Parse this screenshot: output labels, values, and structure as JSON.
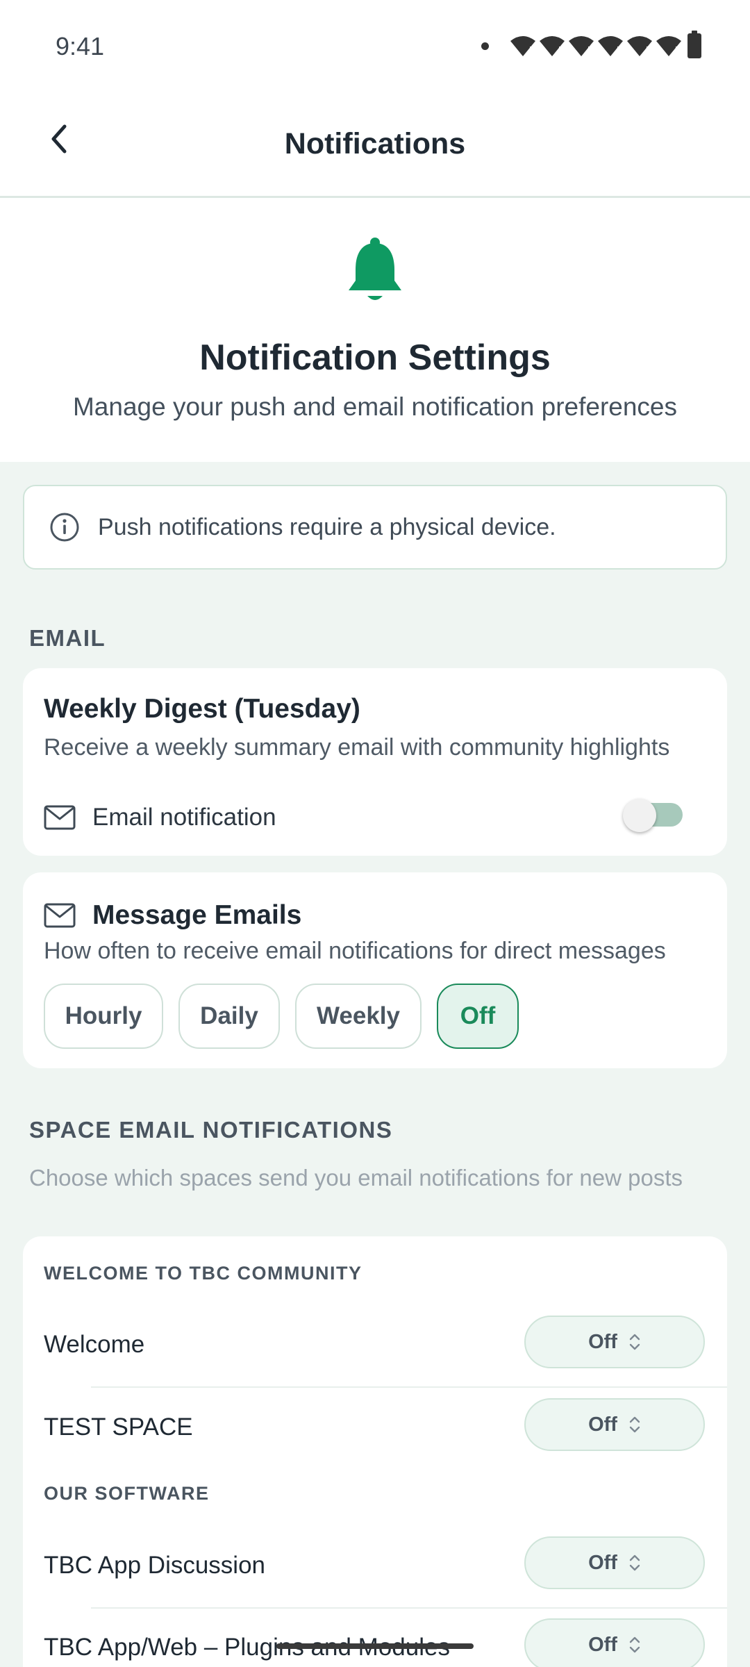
{
  "status_bar": {
    "time": "9:41"
  },
  "header": {
    "title": "Notifications"
  },
  "hero": {
    "title": "Notification Settings",
    "subtitle": "Manage your push and email notification preferences",
    "accent_color": "#0f9a62"
  },
  "info_banner": {
    "text": "Push notifications require a physical device."
  },
  "email_section": {
    "label": "EMAIL",
    "weekly_digest": {
      "title": "Weekly Digest (Tuesday)",
      "description": "Receive a weekly summary email with community highlights",
      "toggle_label": "Email notification",
      "toggle_on": false
    },
    "message_emails": {
      "title": "Message Emails",
      "description": "How often to receive email notifications for direct messages",
      "options": [
        "Hourly",
        "Daily",
        "Weekly",
        "Off"
      ],
      "selected": "Off"
    }
  },
  "space_section": {
    "label": "SPACE EMAIL NOTIFICATIONS",
    "description": "Choose which spaces send you email notifications for new posts",
    "groups": [
      {
        "label": "WELCOME TO TBC COMMUNITY",
        "spaces": [
          {
            "name": "Welcome",
            "value": "Off"
          },
          {
            "name": "TEST SPACE",
            "value": "Off"
          }
        ]
      },
      {
        "label": "OUR SOFTWARE",
        "spaces": [
          {
            "name": "TBC App Discussion",
            "value": "Off"
          },
          {
            "name": "TBC App/Web – Plugins and Modules",
            "value": "Off"
          }
        ]
      }
    ]
  }
}
